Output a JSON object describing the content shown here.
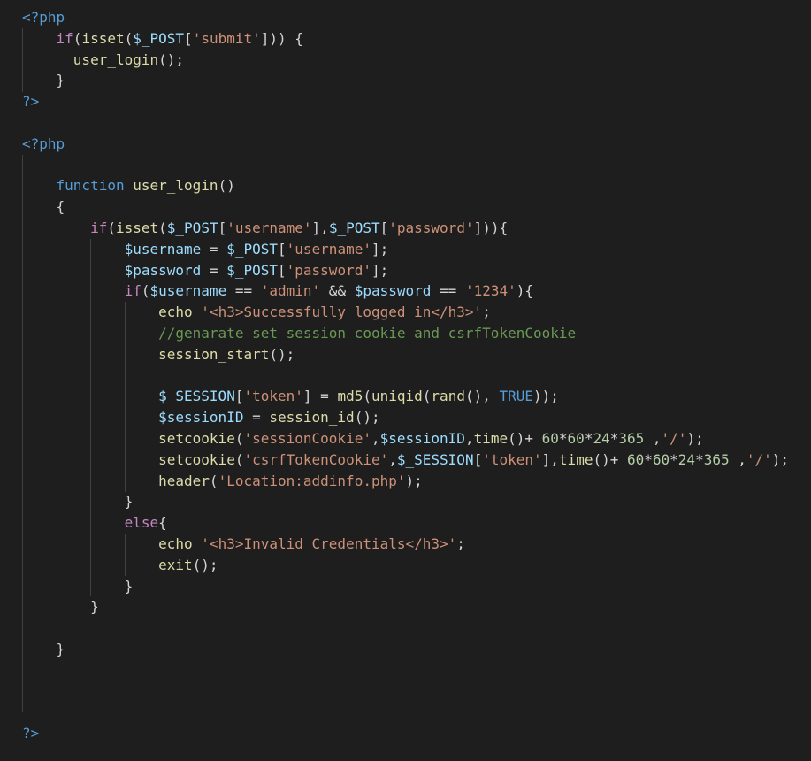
{
  "editor": {
    "language": "php",
    "theme_background": "#1e1e1e",
    "token_colors": {
      "tag": "#569cd6",
      "keyword": "#c586c0",
      "declaration": "#569cd6",
      "function": "#dcdcaa",
      "variable": "#9cdcfe",
      "string": "#ce9178",
      "number": "#b5cea8",
      "comment": "#6a9955",
      "operator": "#d4d4d4"
    },
    "lines": [
      [
        [
          "tag",
          "<?php"
        ]
      ],
      [
        [
          "ws",
          "    "
        ],
        [
          "kw",
          "if"
        ],
        [
          "op",
          "("
        ],
        [
          "fn",
          "isset"
        ],
        [
          "op",
          "("
        ],
        [
          "var",
          "$_POST"
        ],
        [
          "op",
          "["
        ],
        [
          "str",
          "'submit'"
        ],
        [
          "op",
          "])) {"
        ]
      ],
      [
        [
          "ws",
          "      "
        ],
        [
          "fn",
          "user_login"
        ],
        [
          "op",
          "();"
        ]
      ],
      [
        [
          "ws",
          "    "
        ],
        [
          "op",
          "}"
        ]
      ],
      [
        [
          "tag",
          "?>"
        ]
      ],
      [],
      [
        [
          "tag",
          "<?php"
        ]
      ],
      [],
      [
        [
          "ws",
          "    "
        ],
        [
          "dkw",
          "function"
        ],
        [
          "op",
          " "
        ],
        [
          "fn",
          "user_login"
        ],
        [
          "op",
          "()"
        ]
      ],
      [
        [
          "ws",
          "    "
        ],
        [
          "op",
          "{"
        ]
      ],
      [
        [
          "ws",
          "        "
        ],
        [
          "kw",
          "if"
        ],
        [
          "op",
          "("
        ],
        [
          "fn",
          "isset"
        ],
        [
          "op",
          "("
        ],
        [
          "var",
          "$_POST"
        ],
        [
          "op",
          "["
        ],
        [
          "str",
          "'username'"
        ],
        [
          "op",
          "],"
        ],
        [
          "var",
          "$_POST"
        ],
        [
          "op",
          "["
        ],
        [
          "str",
          "'password'"
        ],
        [
          "op",
          "])){"
        ]
      ],
      [
        [
          "ws",
          "            "
        ],
        [
          "var",
          "$username"
        ],
        [
          "op",
          " = "
        ],
        [
          "var",
          "$_POST"
        ],
        [
          "op",
          "["
        ],
        [
          "str",
          "'username'"
        ],
        [
          "op",
          "];"
        ]
      ],
      [
        [
          "ws",
          "            "
        ],
        [
          "var",
          "$password"
        ],
        [
          "op",
          " = "
        ],
        [
          "var",
          "$_POST"
        ],
        [
          "op",
          "["
        ],
        [
          "str",
          "'password'"
        ],
        [
          "op",
          "];"
        ]
      ],
      [
        [
          "ws",
          "            "
        ],
        [
          "kw",
          "if"
        ],
        [
          "op",
          "("
        ],
        [
          "var",
          "$username"
        ],
        [
          "op",
          " == "
        ],
        [
          "str",
          "'admin'"
        ],
        [
          "op",
          " && "
        ],
        [
          "var",
          "$password"
        ],
        [
          "op",
          " == "
        ],
        [
          "str",
          "'1234'"
        ],
        [
          "op",
          "){"
        ]
      ],
      [
        [
          "ws",
          "                "
        ],
        [
          "fn",
          "echo"
        ],
        [
          "op",
          " "
        ],
        [
          "str",
          "'<h3>Successfully logged in</h3>'"
        ],
        [
          "op",
          ";"
        ]
      ],
      [
        [
          "ws",
          "                "
        ],
        [
          "cmt",
          "//genarate set session cookie and csrfTokenCookie"
        ]
      ],
      [
        [
          "ws",
          "                "
        ],
        [
          "fn",
          "session_start"
        ],
        [
          "op",
          "();"
        ]
      ],
      [],
      [
        [
          "ws",
          "                "
        ],
        [
          "var",
          "$_SESSION"
        ],
        [
          "op",
          "["
        ],
        [
          "str",
          "'token'"
        ],
        [
          "op",
          "] = "
        ],
        [
          "fn",
          "md5"
        ],
        [
          "op",
          "("
        ],
        [
          "fn",
          "uniqid"
        ],
        [
          "op",
          "("
        ],
        [
          "fn",
          "rand"
        ],
        [
          "op",
          "(), "
        ],
        [
          "const",
          "TRUE"
        ],
        [
          "op",
          "));"
        ]
      ],
      [
        [
          "ws",
          "                "
        ],
        [
          "var",
          "$sessionID"
        ],
        [
          "op",
          " = "
        ],
        [
          "fn",
          "session_id"
        ],
        [
          "op",
          "();"
        ]
      ],
      [
        [
          "ws",
          "                "
        ],
        [
          "fn",
          "setcookie"
        ],
        [
          "op",
          "("
        ],
        [
          "str",
          "'sessionCookie'"
        ],
        [
          "op",
          ","
        ],
        [
          "var",
          "$sessionID"
        ],
        [
          "op",
          ","
        ],
        [
          "fn",
          "time"
        ],
        [
          "op",
          "()+ "
        ],
        [
          "num",
          "60"
        ],
        [
          "op",
          "*"
        ],
        [
          "num",
          "60"
        ],
        [
          "op",
          "*"
        ],
        [
          "num",
          "24"
        ],
        [
          "op",
          "*"
        ],
        [
          "num",
          "365"
        ],
        [
          "op",
          " ,"
        ],
        [
          "str",
          "'/'"
        ],
        [
          "op",
          ");"
        ]
      ],
      [
        [
          "ws",
          "                "
        ],
        [
          "fn",
          "setcookie"
        ],
        [
          "op",
          "("
        ],
        [
          "str",
          "'csrfTokenCookie'"
        ],
        [
          "op",
          ","
        ],
        [
          "var",
          "$_SESSION"
        ],
        [
          "op",
          "["
        ],
        [
          "str",
          "'token'"
        ],
        [
          "op",
          "],"
        ],
        [
          "fn",
          "time"
        ],
        [
          "op",
          "()+ "
        ],
        [
          "num",
          "60"
        ],
        [
          "op",
          "*"
        ],
        [
          "num",
          "60"
        ],
        [
          "op",
          "*"
        ],
        [
          "num",
          "24"
        ],
        [
          "op",
          "*"
        ],
        [
          "num",
          "365"
        ],
        [
          "op",
          " ,"
        ],
        [
          "str",
          "'/'"
        ],
        [
          "op",
          ");"
        ]
      ],
      [
        [
          "ws",
          "                "
        ],
        [
          "fn",
          "header"
        ],
        [
          "op",
          "("
        ],
        [
          "str",
          "'Location:addinfo.php'"
        ],
        [
          "op",
          ");"
        ]
      ],
      [
        [
          "ws",
          "            "
        ],
        [
          "op",
          "}"
        ]
      ],
      [
        [
          "ws",
          "            "
        ],
        [
          "kw",
          "else"
        ],
        [
          "op",
          "{"
        ]
      ],
      [
        [
          "ws",
          "                "
        ],
        [
          "fn",
          "echo"
        ],
        [
          "op",
          " "
        ],
        [
          "str",
          "'<h3>Invalid Credentials</h3>'"
        ],
        [
          "op",
          ";"
        ]
      ],
      [
        [
          "ws",
          "                "
        ],
        [
          "fn",
          "exit"
        ],
        [
          "op",
          "();"
        ]
      ],
      [
        [
          "ws",
          "            "
        ],
        [
          "op",
          "}"
        ]
      ],
      [
        [
          "ws",
          "        "
        ],
        [
          "op",
          "}"
        ]
      ],
      [],
      [
        [
          "ws",
          "    "
        ],
        [
          "op",
          "}"
        ]
      ],
      [],
      [],
      [],
      [
        [
          "tag",
          "?>"
        ]
      ]
    ]
  }
}
